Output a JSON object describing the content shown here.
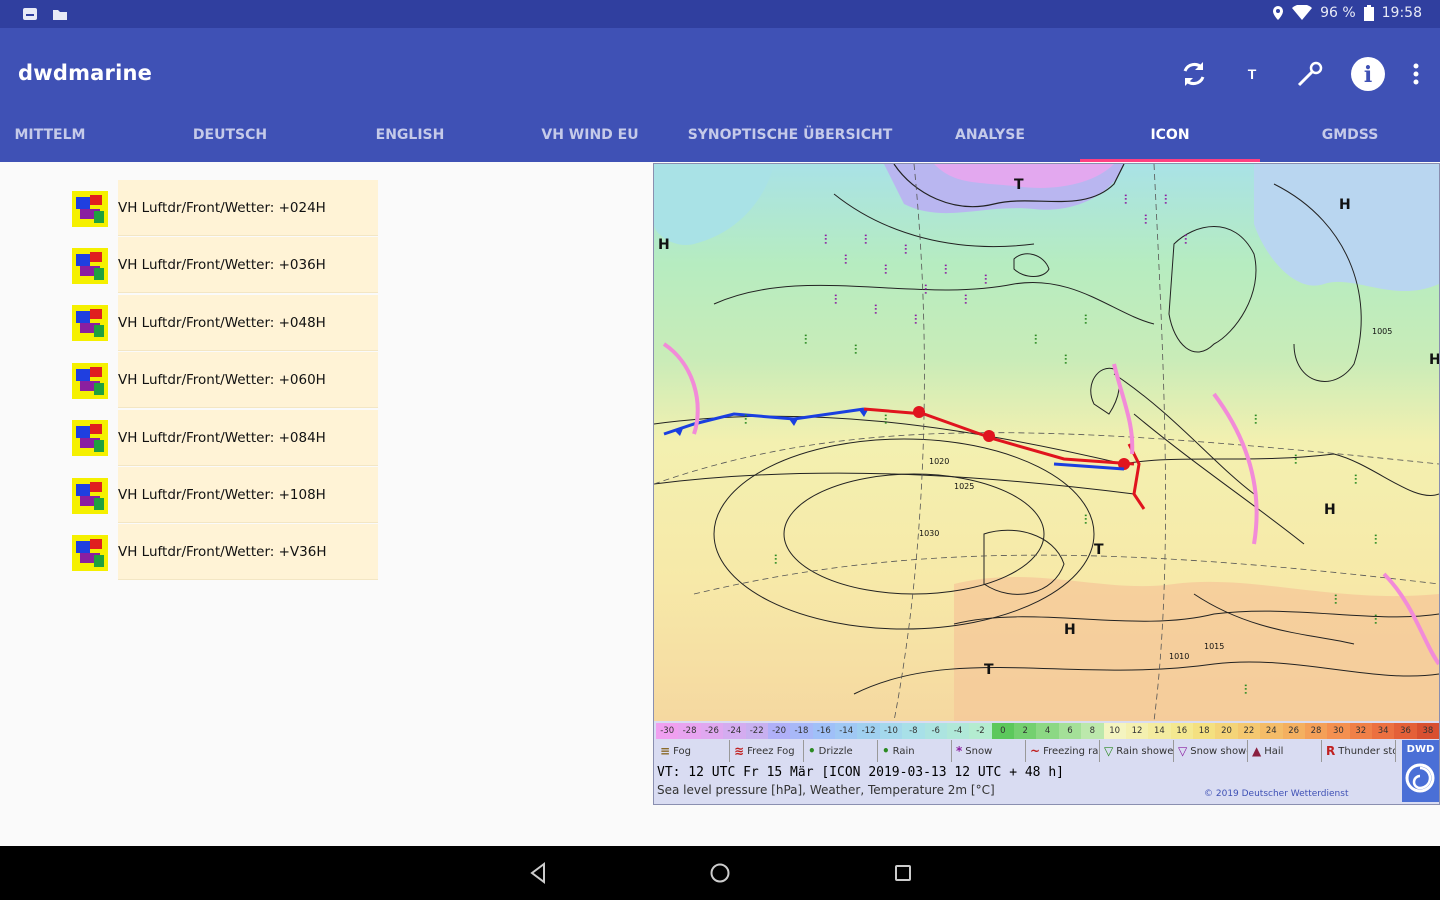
{
  "status_bar": {
    "battery": "96 %",
    "time": "19:58",
    "left_icons": [
      "notification-icon",
      "folder-icon"
    ],
    "right_icons": [
      "location-icon",
      "wifi-icon",
      "battery-icon"
    ]
  },
  "app_bar": {
    "title": "dwdmarine",
    "actions": [
      "refresh-icon",
      "text-size-icon",
      "settings-tool-icon",
      "info-icon",
      "overflow-menu-icon"
    ],
    "text_action_label": "T",
    "info_glyph": "i"
  },
  "tabs": [
    {
      "label": "MITTELM",
      "active": false
    },
    {
      "label": "DEUTSCH",
      "active": false
    },
    {
      "label": "ENGLISH",
      "active": false
    },
    {
      "label": "VH WIND EU",
      "active": false
    },
    {
      "label": "SYNOPTISCHE ÜBERSICHT",
      "active": false
    },
    {
      "label": "ANALYSE",
      "active": false
    },
    {
      "label": "ICON",
      "active": true
    },
    {
      "label": "GMDSS",
      "active": false
    }
  ],
  "list": {
    "items": [
      {
        "label": "VH Luftdr/Front/Wetter: +024H"
      },
      {
        "label": "VH Luftdr/Front/Wetter: +036H"
      },
      {
        "label": "VH Luftdr/Front/Wetter: +048H"
      },
      {
        "label": "VH Luftdr/Front/Wetter: +060H"
      },
      {
        "label": "VH Luftdr/Front/Wetter: +084H"
      },
      {
        "label": "VH Luftdr/Front/Wetter: +108H"
      },
      {
        "label": "VH Luftdr/Front/Wetter: +V36H"
      }
    ]
  },
  "map": {
    "temperature_scale": [
      "-30",
      "-28",
      "-26",
      "-24",
      "-22",
      "-20",
      "-18",
      "-16",
      "-14",
      "-12",
      "-10",
      "-8",
      "-6",
      "-4",
      "-2",
      "0",
      "2",
      "4",
      "6",
      "8",
      "10",
      "12",
      "14",
      "16",
      "18",
      "20",
      "22",
      "24",
      "26",
      "28",
      "30",
      "32",
      "34",
      "36",
      "38"
    ],
    "weather_legend": [
      {
        "symbol": "≡",
        "label": "Fog"
      },
      {
        "symbol": "≋",
        "label": "Freez Fog"
      },
      {
        "symbol": "•",
        "label": "Drizzle"
      },
      {
        "symbol": "•",
        "label": "Rain"
      },
      {
        "symbol": "*",
        "label": "Snow"
      },
      {
        "symbol": "~",
        "label": "Freezing rain"
      },
      {
        "symbol": "▽",
        "label": "Rain shower"
      },
      {
        "symbol": "▽",
        "label": "Snow shower"
      },
      {
        "symbol": "▲",
        "label": "Hail"
      },
      {
        "symbol": "R",
        "label": "Thunder storm"
      }
    ],
    "valid_time": "VT: 12 UTC Fr  15 Mär [ICON 2019-03-13  12 UTC + 48 h]",
    "description": "Sea level pressure [hPa], Weather, Temperature 2m [°C]",
    "copyright": "© 2019 Deutscher Wetterdienst",
    "logo_text": "DWD",
    "isobar_labels": [
      "1020",
      "1025",
      "1030",
      "1015",
      "1010",
      "1005"
    ],
    "pressure_centers": [
      "H",
      "T",
      "H",
      "H",
      "T",
      "H",
      "H",
      "T"
    ],
    "colors": {
      "warm": "#f7e9a8",
      "mild": "#c8ecc0",
      "cool": "#a9e2e6",
      "cold": "#b9b6f0",
      "very_cold": "#e3a8ef",
      "hot": "#f5c99a",
      "cold_front": "#1a3fe0",
      "warm_front": "#e0141e",
      "occlusion": "#f28bd8",
      "precip_symbol": "#2b8a22",
      "snow_symbol": "#8a1fa0"
    }
  },
  "nav_bar": {
    "buttons": [
      "back-icon",
      "home-icon",
      "recents-icon"
    ]
  }
}
